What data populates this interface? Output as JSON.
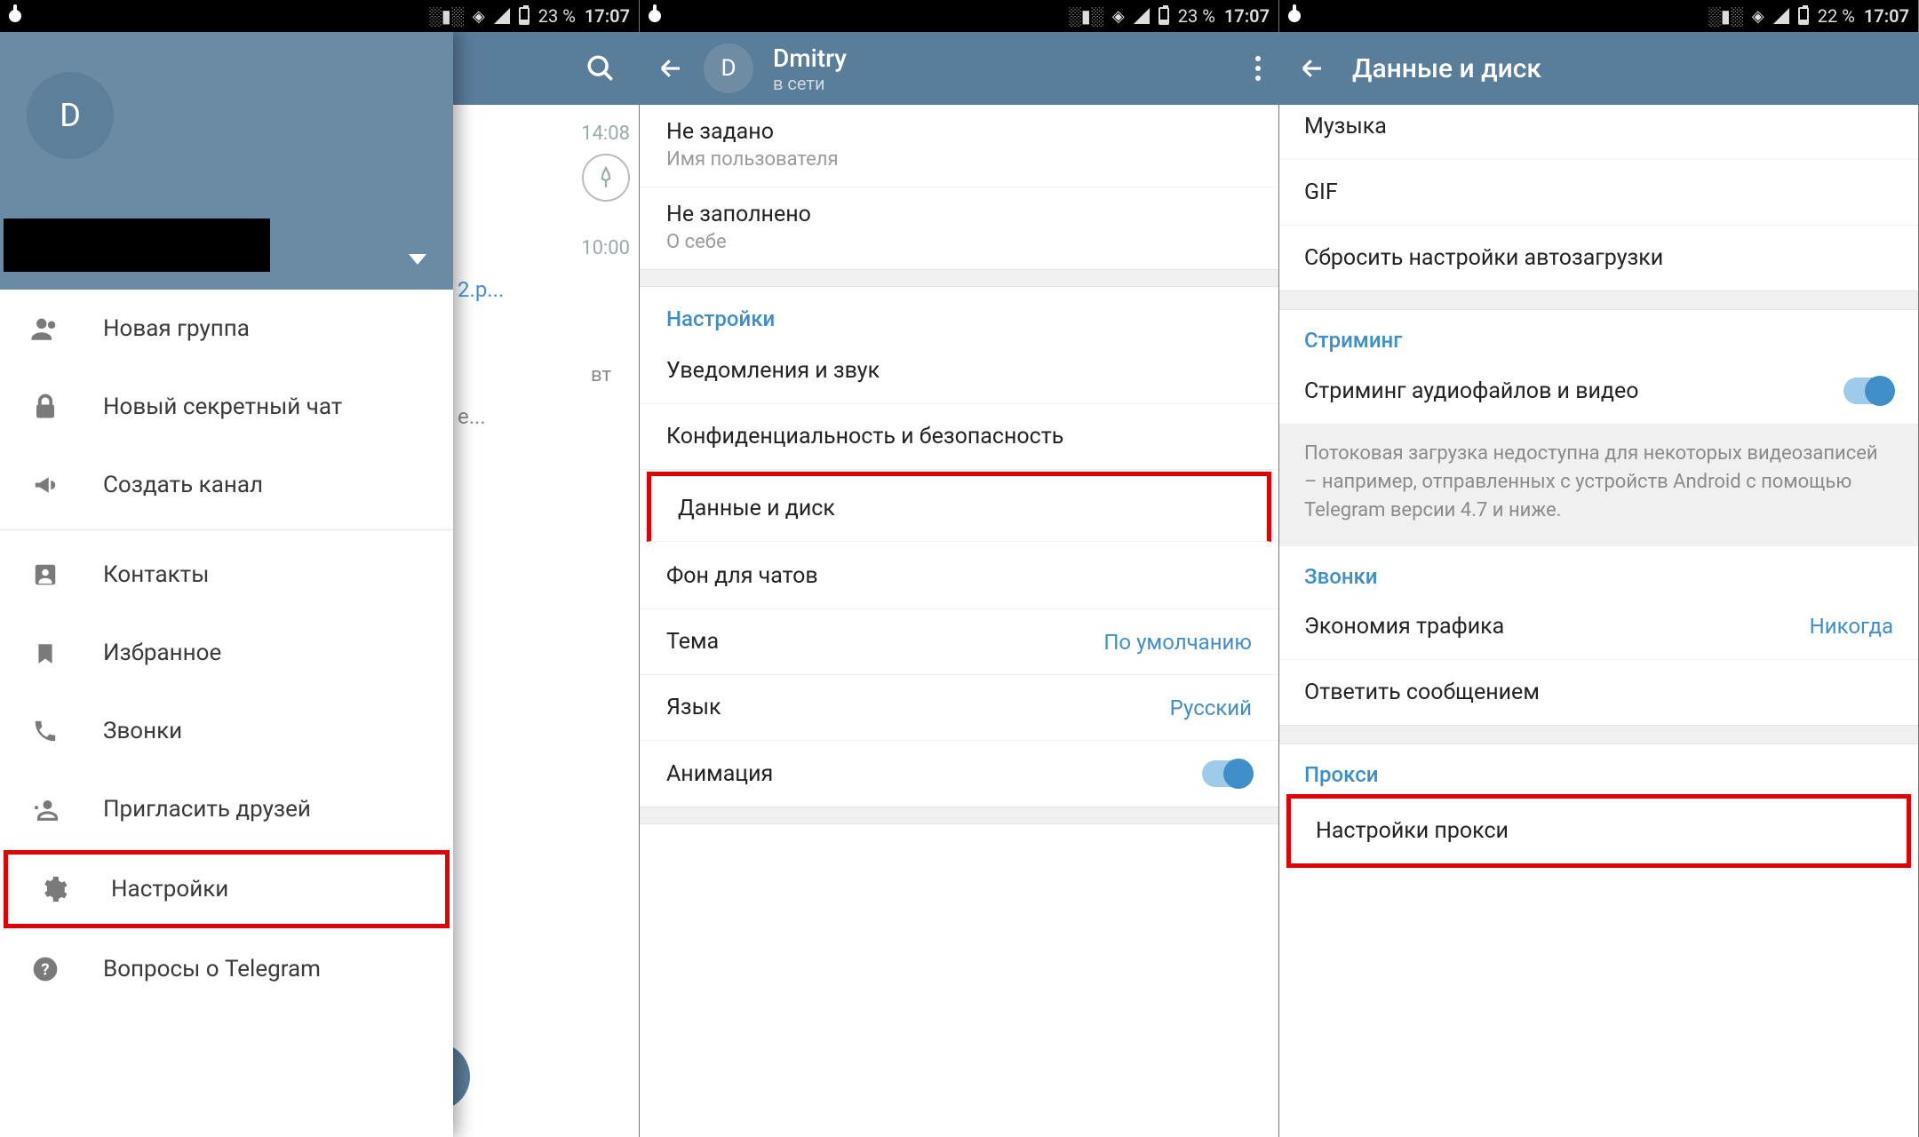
{
  "status": {
    "battery1": "23 %",
    "battery2": "23 %",
    "battery3": "22 %",
    "time": "17:07"
  },
  "screen1": {
    "avatar_letter": "D",
    "chat_time1": "14:08",
    "chat_time2": "10:00",
    "chat_frag": "2.p...",
    "chat_day": "вт",
    "chat_ellipsis": "е...",
    "menu": {
      "new_group": "Новая группа",
      "secret_chat": "Новый секретный чат",
      "new_channel": "Создать канал",
      "contacts": "Контакты",
      "saved": "Избранное",
      "calls": "Звонки",
      "invite": "Пригласить друзей",
      "settings": "Настройки",
      "faq": "Вопросы о Telegram"
    }
  },
  "screen2": {
    "name": "Dmitry",
    "online": "в сети",
    "username_value": "Не задано",
    "username_label": "Имя пользователя",
    "bio_value": "Не заполнено",
    "bio_label": "О себе",
    "section": "Настройки",
    "rows": {
      "notifications": "Уведомления и звук",
      "privacy": "Конфиденциальность и безопасность",
      "data": "Данные и диск",
      "bg": "Фон для чатов",
      "theme": "Тема",
      "theme_val": "По умолчанию",
      "lang": "Язык",
      "lang_val": "Русский",
      "anim": "Анимация"
    }
  },
  "screen3": {
    "title": "Данные и диск",
    "row_music": "Музыка",
    "row_gif": "GIF",
    "row_reset": "Сбросить настройки автозагрузки",
    "sect_streaming": "Стриминг",
    "row_streaming": "Стриминг аудиофайлов и видео",
    "desc_streaming": "Потоковая загрузка недоступна для некоторых видеозаписей – например, отправленных с устройств Android с помощью Telegram версии 4.7 и ниже.",
    "sect_calls": "Звонки",
    "row_datasave": "Экономия трафика",
    "row_datasave_val": "Никогда",
    "row_reply": "Ответить сообщением",
    "sect_proxy": "Прокси",
    "row_proxy": "Настройки прокси"
  }
}
